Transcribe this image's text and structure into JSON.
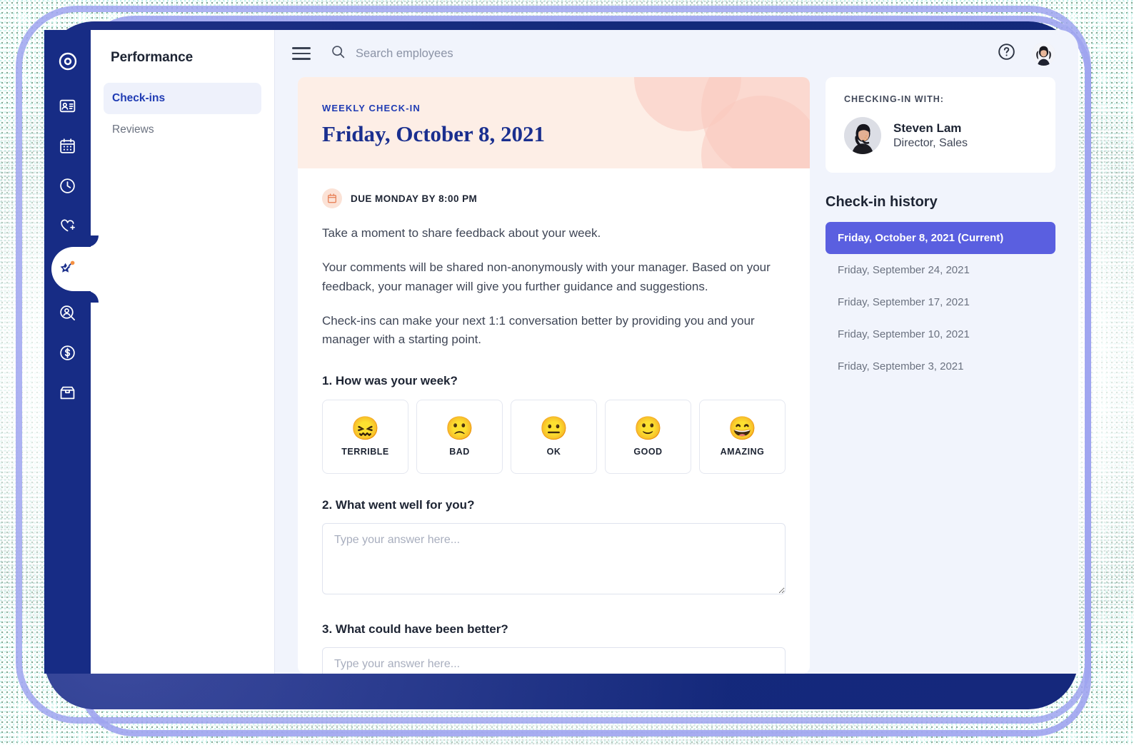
{
  "app": {
    "rail": [
      {
        "name": "logo",
        "icon": "circle-logo-icon"
      },
      {
        "name": "directory",
        "icon": "id-card-icon"
      },
      {
        "name": "calendar",
        "icon": "calendar-icon"
      },
      {
        "name": "time-tracking",
        "icon": "clock-icon"
      },
      {
        "name": "benefits",
        "icon": "heart-plus-icon"
      },
      {
        "name": "performance",
        "icon": "star-sparkle-icon",
        "active": true
      },
      {
        "name": "recruiting",
        "icon": "person-search-icon"
      },
      {
        "name": "payroll",
        "icon": "dollar-circle-icon"
      },
      {
        "name": "apps",
        "icon": "store-icon"
      }
    ]
  },
  "panel": {
    "title": "Performance",
    "links": [
      {
        "label": "Check-ins",
        "selected": true
      },
      {
        "label": "Reviews",
        "selected": false
      }
    ]
  },
  "topbar": {
    "menu_icon": "hamburger-icon",
    "search_icon": "search-icon",
    "search_placeholder": "Search employees",
    "search_value": "",
    "help_icon": "question-circle-icon",
    "avatar_icon": "user-avatar"
  },
  "checkin": {
    "eyebrow": "WEEKLY CHECK-IN",
    "date": "Friday, October 8, 2021",
    "due_icon": "calendar-icon",
    "due": "DUE MONDAY BY 8:00 PM",
    "paragraphs": [
      "Take a moment to share feedback about your week.",
      "Your comments will be shared non-anonymously with your manager. Based on your feedback, your manager will give you further guidance and suggestions.",
      "Check-ins can make your next 1:1 conversation better by providing you and your manager with a starting point."
    ],
    "questions": [
      {
        "title": "1. How was your week?",
        "type": "mood",
        "options": [
          {
            "label": "TERRIBLE",
            "emoji": "😖"
          },
          {
            "label": "BAD",
            "emoji": "🙁"
          },
          {
            "label": "OK",
            "emoji": "😐"
          },
          {
            "label": "GOOD",
            "emoji": "🙂"
          },
          {
            "label": "AMAZING",
            "emoji": "😄"
          }
        ]
      },
      {
        "title": "2. What went well for you?",
        "type": "text",
        "placeholder": "Type your answer here...",
        "value": ""
      },
      {
        "title": "3. What could have been better?",
        "type": "text",
        "placeholder": "Type your answer here...",
        "value": ""
      }
    ]
  },
  "sidebar": {
    "with_label": "CHECKING-IN WITH:",
    "manager": {
      "name": "Steven Lam",
      "role": "Director, Sales"
    },
    "history_title": "Check-in history",
    "history": [
      {
        "label": "Friday, October 8, 2021 (Current)",
        "current": true
      },
      {
        "label": "Friday, September 24, 2021",
        "current": false
      },
      {
        "label": "Friday, September 17, 2021",
        "current": false
      },
      {
        "label": "Friday, September 10, 2021",
        "current": false
      },
      {
        "label": "Friday, September 3, 2021",
        "current": false
      }
    ]
  },
  "colors": {
    "navy": "#172c85",
    "accent_periwinkle": "#9fa4f0",
    "history_active": "#5a5fe0",
    "banner_bg": "#fdeee6",
    "banner_text": "#1a2f8f",
    "link_active": "#1f3bb3",
    "due_badge": "#fbe2d6",
    "content_bg": "#f1f4fc"
  }
}
